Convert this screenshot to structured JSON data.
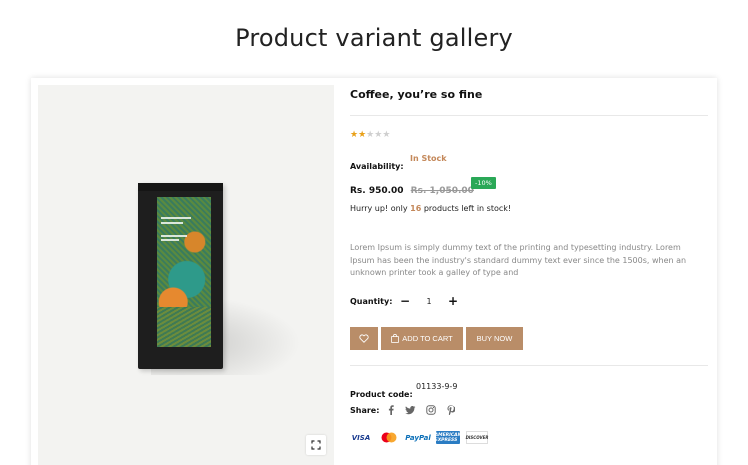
{
  "section_title": "Product variant gallery",
  "product": {
    "title": "Coffee, you’re so fine",
    "rating": {
      "value": 2,
      "max": 5
    },
    "availability_label": "Availability:",
    "availability_value": "In Stock",
    "price": "Rs. 950.00",
    "old_price": "Rs. 1,050.00",
    "discount": "-10%",
    "stock_note_prefix": "Hurry up! only ",
    "stock_count": "16",
    "stock_note_suffix": " products left in stock!",
    "description": "Lorem Ipsum is simply dummy text of the printing and typesetting industry. Lorem Ipsum has been the industry's standard dummy text ever since the 1500s, when an unknown printer took a galley of type and",
    "quantity_label": "Quantity:",
    "quantity_value": "1",
    "add_to_cart_label": "ADD TO CART",
    "buy_now_label": "BUY NOW",
    "code_label": "Product code:",
    "code_value": "01133-9-9",
    "share_label": "Share:",
    "share_icons": [
      "facebook-icon",
      "twitter-icon",
      "instagram-icon",
      "pinterest-icon"
    ],
    "payments": {
      "visa": "VISA",
      "paypal": "PayPal",
      "amex": "AMERICAN EXPRESS",
      "discover": "DISCOVER"
    }
  },
  "colors": {
    "accent": "#b98d68",
    "accent_text": "#c4885a",
    "discount_bg": "#2aa857",
    "star_on": "#e8a019",
    "star_off": "#cfcfcf"
  }
}
